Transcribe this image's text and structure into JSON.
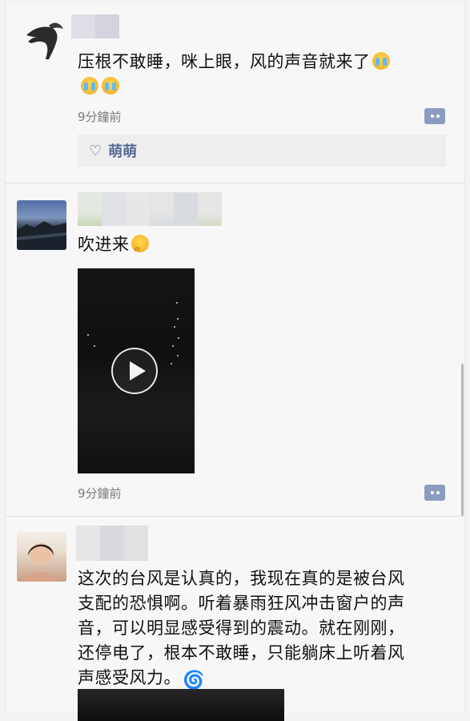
{
  "posts": [
    {
      "text": "压根不敢睡，咪上眼，风的声音就来了",
      "time": "9分鐘前",
      "likes": "萌萌"
    },
    {
      "text": "吹进来",
      "time": "9分鐘前"
    },
    {
      "lines": [
        "这次的台风是认真的，我现在真的是被台风",
        "支配的恐惧啊。听着暴雨狂风冲击窗户的声",
        "音，可以明显感受得到的震动。就在刚刚，",
        "还停电了，根本不敢睡，只能躺床上听着风",
        "声感受风力。"
      ]
    }
  ],
  "icons": {
    "emoji_sob": "loudly-crying-face",
    "emoji_think": "thinking-face",
    "emoji_cyclone": "cyclone"
  },
  "colors": {
    "link_blue": "#576b95",
    "more_button": "#8b9cc1"
  }
}
